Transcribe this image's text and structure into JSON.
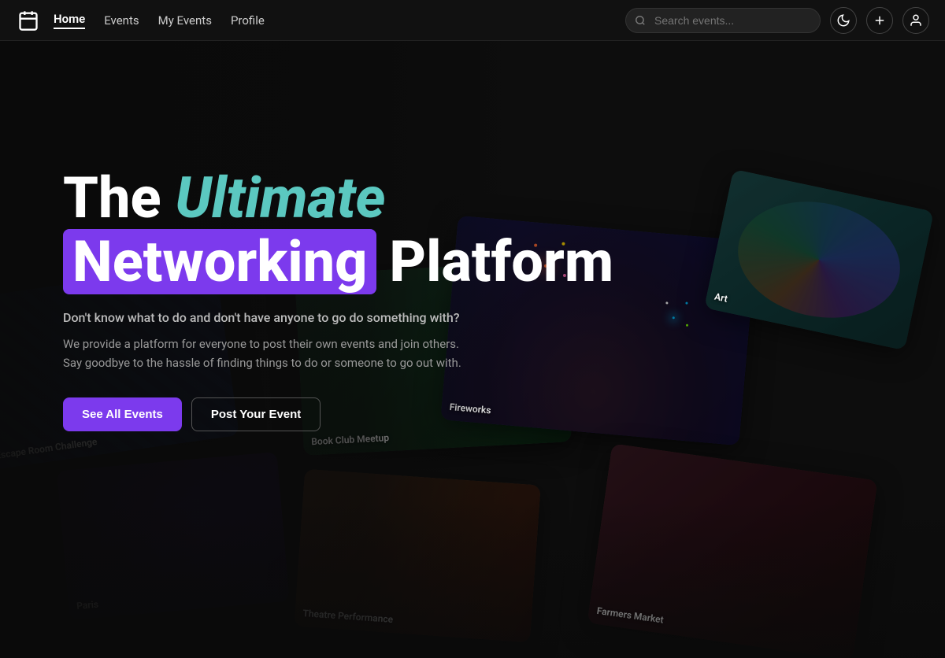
{
  "navbar": {
    "logo_label": "calendar-icon",
    "links": [
      {
        "label": "Home",
        "active": true,
        "name": "home"
      },
      {
        "label": "Events",
        "active": false,
        "name": "events"
      },
      {
        "label": "My Events",
        "active": false,
        "name": "my-events"
      },
      {
        "label": "Profile",
        "active": false,
        "name": "profile"
      }
    ],
    "search": {
      "placeholder": "Search events..."
    },
    "icons": {
      "dark_mode": "moon-icon",
      "add": "plus-icon",
      "profile": "user-icon"
    }
  },
  "hero": {
    "title_prefix": "The",
    "title_accent": "Ultimate",
    "title_highlight": "Networking",
    "title_suffix": "Platform",
    "subtitle": "Don't know what to do and don't have anyone to go do something with?",
    "description_line1": "We provide a platform for everyone to post their own events and join others.",
    "description_line2": "Say goodbye to the hassle of finding things to do or someone to go out with.",
    "btn_primary": "See All Events",
    "btn_secondary": "Post Your Event",
    "accent_color": "#5bc8c0",
    "highlight_color": "#7c3aed"
  },
  "event_cards": [
    {
      "label": "Escape Room Challenge",
      "position": "bottom-left-1"
    },
    {
      "label": "Paris",
      "position": "bottom-left-2"
    },
    {
      "label": "Book Club Meetup",
      "position": "center"
    },
    {
      "label": "Theatre Performance",
      "position": "bottom-center"
    },
    {
      "label": "Fireworks",
      "position": "right-center"
    },
    {
      "label": "Farmers Market",
      "position": "far-right"
    },
    {
      "label": "Art",
      "position": "top-right"
    }
  ]
}
